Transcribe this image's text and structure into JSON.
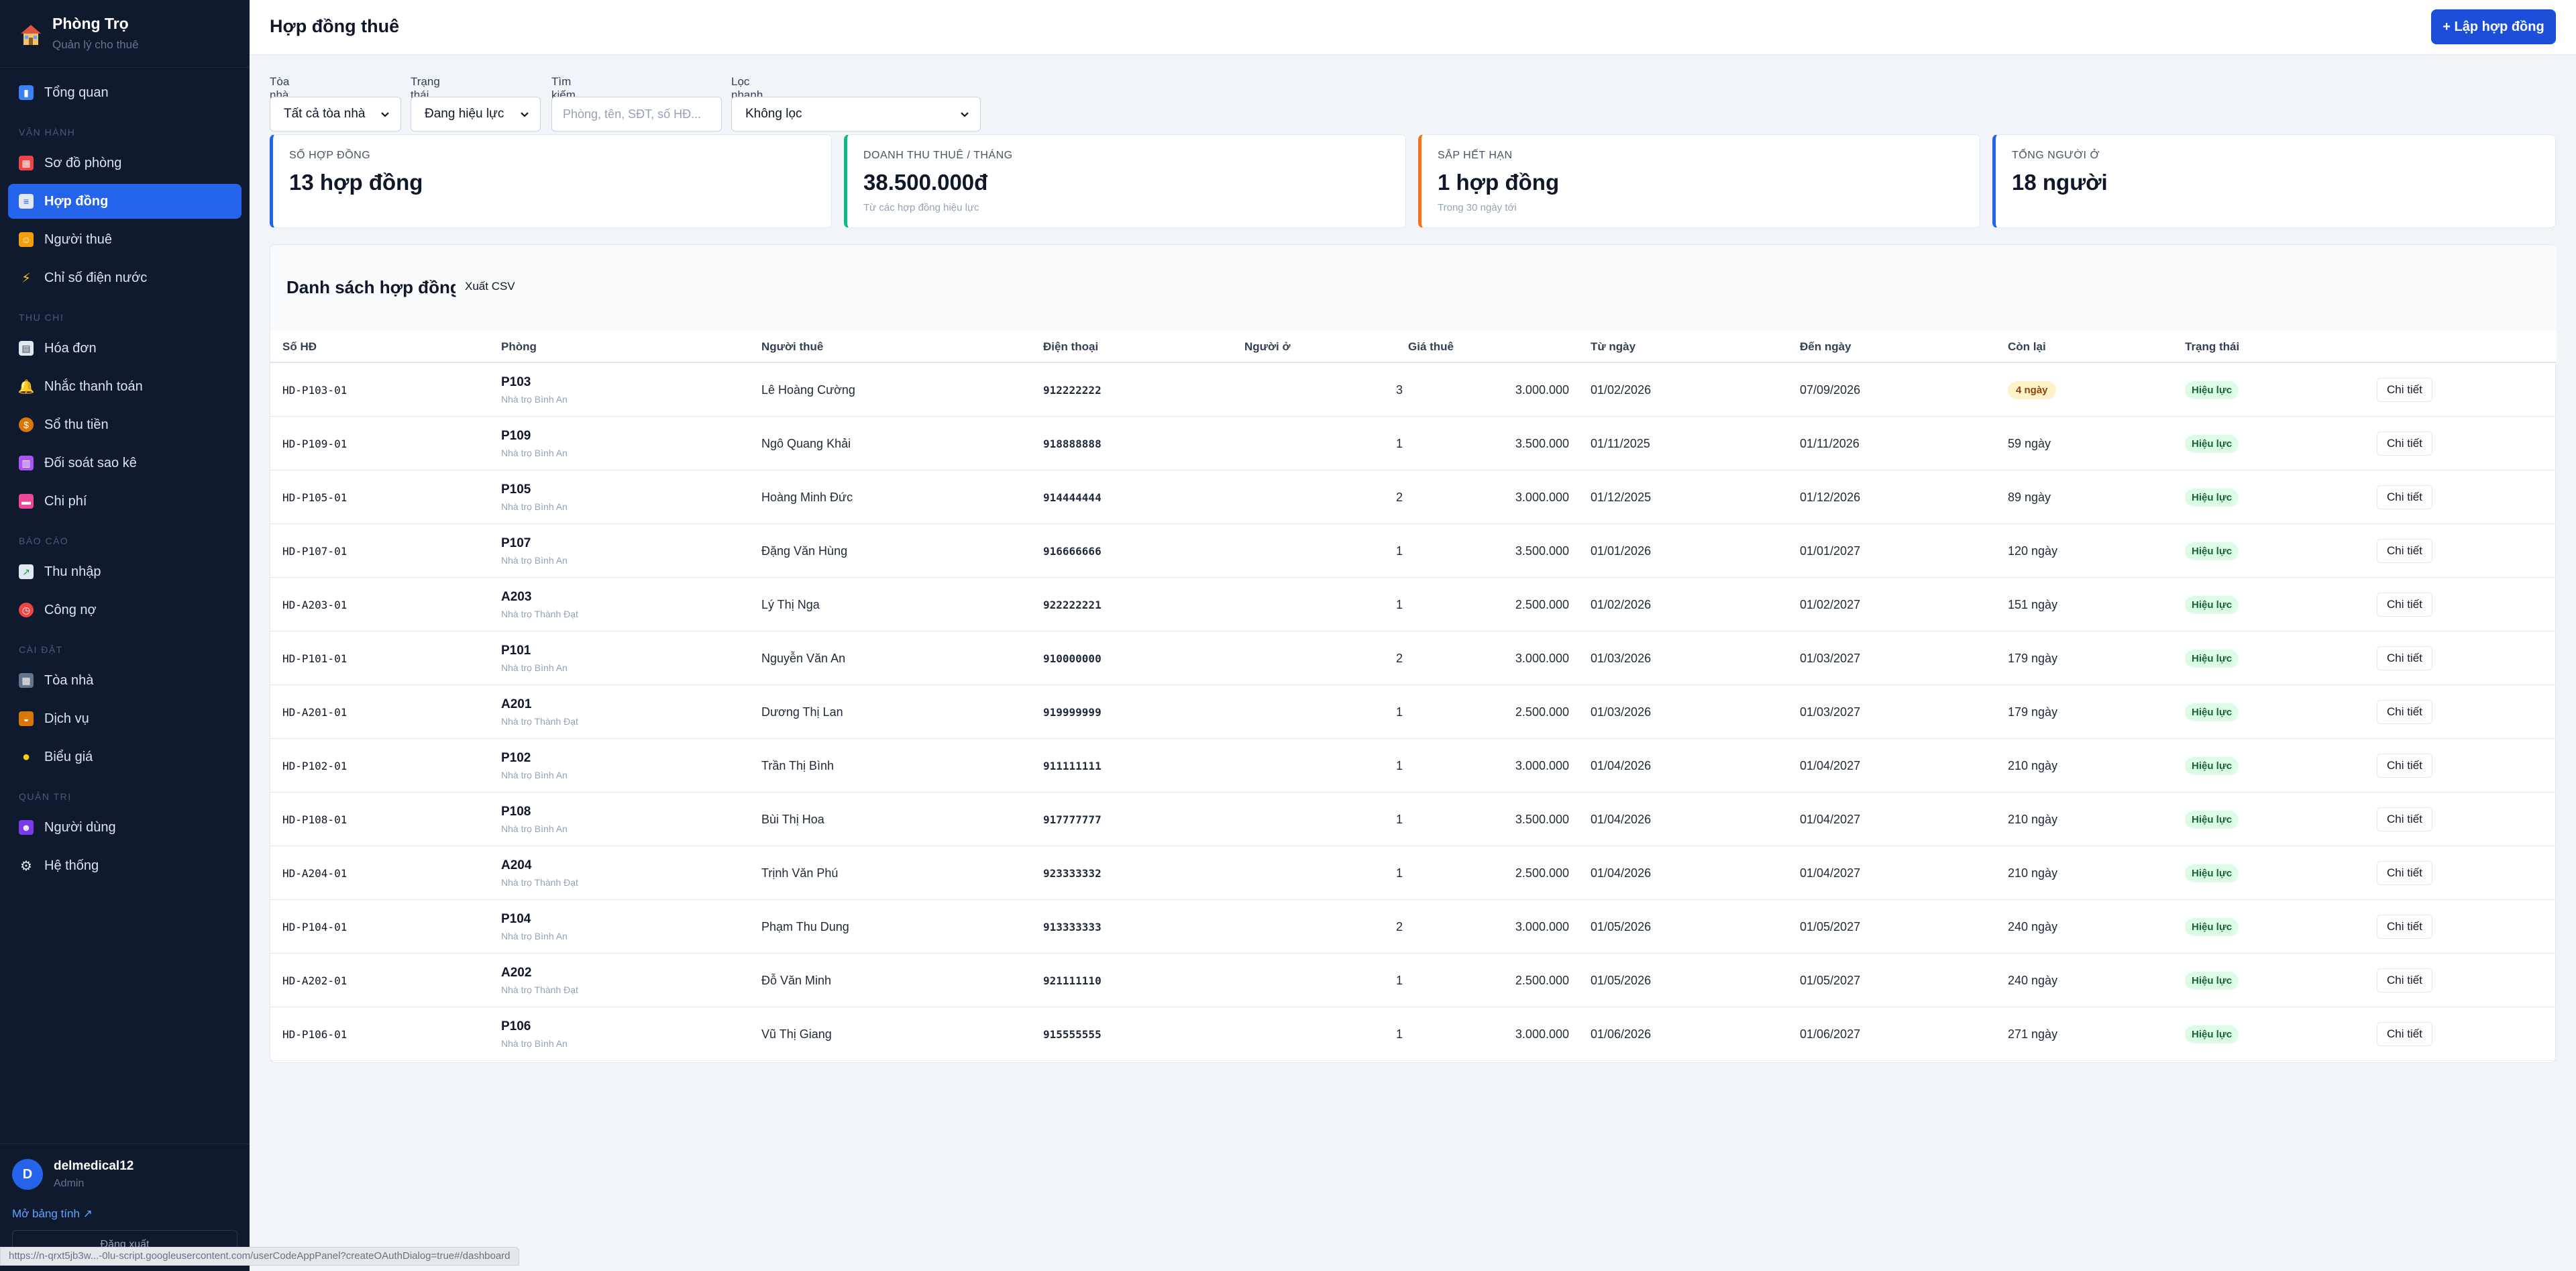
{
  "brand": {
    "title": "Phòng Trọ",
    "subtitle": "Quản lý cho thuê"
  },
  "nav": {
    "overview": "Tổng quan",
    "sec_ops": "Vận hành",
    "room_map": "Sơ đồ phòng",
    "contracts": "Hợp đồng",
    "tenants": "Người thuê",
    "meters": "Chỉ số điện nước",
    "sec_finance": "Thu chi",
    "invoices": "Hóa đơn",
    "reminders": "Nhắc thanh toán",
    "cashbook": "Sổ thu tiền",
    "reconcile": "Đối soát sao kê",
    "expenses": "Chi phí",
    "sec_reports": "Báo cáo",
    "income": "Thu nhập",
    "debts": "Công nợ",
    "sec_settings": "Cài đặt",
    "buildings": "Tòa nhà",
    "services": "Dịch vụ",
    "pricing": "Biểu giá",
    "sec_admin": "Quản trị",
    "users": "Người dùng",
    "system": "Hệ thống"
  },
  "user": {
    "initial": "D",
    "name": "delmedical12",
    "role": "Admin",
    "open_sheet": "Mở bảng tính ↗",
    "logout": "Đăng xuất"
  },
  "status_url": "https://n-qrxt5jb3w...-0lu-script.googleusercontent.com/userCodeAppPanel?createOAuthDialog=true#/dashboard",
  "header": {
    "title": "Hợp đồng thuê",
    "new_button": "+ Lập hợp đồng"
  },
  "filters": {
    "building_label": "Tòa nhà",
    "building_value": "Tất cả tòa nhà",
    "status_label": "Trạng thái",
    "status_value": "Đang hiệu lực",
    "search_label": "Tìm kiếm",
    "search_placeholder": "Phòng, tên, SĐT, số HĐ...",
    "quick_label": "Lọc nhanh",
    "quick_value": "Không lọc"
  },
  "stats": [
    {
      "label": "Số hợp đồng",
      "value": "13 hợp đồng",
      "note": "",
      "color": "#2563eb"
    },
    {
      "label": "Doanh thu thuê / tháng",
      "value": "38.500.000đ",
      "note": "Từ các hợp đồng hiệu lực",
      "color": "#10b981"
    },
    {
      "label": "Sắp hết hạn",
      "value": "1 hợp đồng",
      "note": "Trong 30 ngày tới",
      "color": "#f97316"
    },
    {
      "label": "Tổng người ở",
      "value": "18 người",
      "note": "",
      "color": "#2563eb"
    }
  ],
  "table": {
    "title": "Danh sách hợp đồng",
    "export": "Xuất CSV",
    "columns": [
      "Số HĐ",
      "Phòng",
      "Người thuê",
      "Điện thoại",
      "Người ở",
      "Giá thuê",
      "Từ ngày",
      "Đến ngày",
      "Còn lại",
      "Trạng thái"
    ],
    "detail_label": "Chi tiết",
    "rows": [
      {
        "id": "HD-P103-01",
        "room": "P103",
        "building": "Nhà trọ Bình An",
        "tenant": "Lê Hoàng Cường",
        "phone": "912222222",
        "occupants": "3",
        "rent": "3.000.000",
        "from": "01/02/2026",
        "to": "07/09/2026",
        "left": "4 ngày",
        "warn": true,
        "status": "Hiệu lực"
      },
      {
        "id": "HD-P109-01",
        "room": "P109",
        "building": "Nhà trọ Bình An",
        "tenant": "Ngô Quang Khải",
        "phone": "918888888",
        "occupants": "1",
        "rent": "3.500.000",
        "from": "01/11/2025",
        "to": "01/11/2026",
        "left": "59 ngày",
        "warn": false,
        "status": "Hiệu lực"
      },
      {
        "id": "HD-P105-01",
        "room": "P105",
        "building": "Nhà trọ Bình An",
        "tenant": "Hoàng Minh Đức",
        "phone": "914444444",
        "occupants": "2",
        "rent": "3.000.000",
        "from": "01/12/2025",
        "to": "01/12/2026",
        "left": "89 ngày",
        "warn": false,
        "status": "Hiệu lực"
      },
      {
        "id": "HD-P107-01",
        "room": "P107",
        "building": "Nhà trọ Bình An",
        "tenant": "Đặng Văn Hùng",
        "phone": "916666666",
        "occupants": "1",
        "rent": "3.500.000",
        "from": "01/01/2026",
        "to": "01/01/2027",
        "left": "120 ngày",
        "warn": false,
        "status": "Hiệu lực"
      },
      {
        "id": "HD-A203-01",
        "room": "A203",
        "building": "Nhà trọ Thành Đạt",
        "tenant": "Lý Thị Nga",
        "phone": "922222221",
        "occupants": "1",
        "rent": "2.500.000",
        "from": "01/02/2026",
        "to": "01/02/2027",
        "left": "151 ngày",
        "warn": false,
        "status": "Hiệu lực"
      },
      {
        "id": "HD-P101-01",
        "room": "P101",
        "building": "Nhà trọ Bình An",
        "tenant": "Nguyễn Văn An",
        "phone": "910000000",
        "occupants": "2",
        "rent": "3.000.000",
        "from": "01/03/2026",
        "to": "01/03/2027",
        "left": "179 ngày",
        "warn": false,
        "status": "Hiệu lực"
      },
      {
        "id": "HD-A201-01",
        "room": "A201",
        "building": "Nhà trọ Thành Đạt",
        "tenant": "Dương Thị Lan",
        "phone": "919999999",
        "occupants": "1",
        "rent": "2.500.000",
        "from": "01/03/2026",
        "to": "01/03/2027",
        "left": "179 ngày",
        "warn": false,
        "status": "Hiệu lực"
      },
      {
        "id": "HD-P102-01",
        "room": "P102",
        "building": "Nhà trọ Bình An",
        "tenant": "Trần Thị Bình",
        "phone": "911111111",
        "occupants": "1",
        "rent": "3.000.000",
        "from": "01/04/2026",
        "to": "01/04/2027",
        "left": "210 ngày",
        "warn": false,
        "status": "Hiệu lực"
      },
      {
        "id": "HD-P108-01",
        "room": "P108",
        "building": "Nhà trọ Bình An",
        "tenant": "Bùi Thị Hoa",
        "phone": "917777777",
        "occupants": "1",
        "rent": "3.500.000",
        "from": "01/04/2026",
        "to": "01/04/2027",
        "left": "210 ngày",
        "warn": false,
        "status": "Hiệu lực"
      },
      {
        "id": "HD-A204-01",
        "room": "A204",
        "building": "Nhà trọ Thành Đạt",
        "tenant": "Trịnh Văn Phú",
        "phone": "923333332",
        "occupants": "1",
        "rent": "2.500.000",
        "from": "01/04/2026",
        "to": "01/04/2027",
        "left": "210 ngày",
        "warn": false,
        "status": "Hiệu lực"
      },
      {
        "id": "HD-P104-01",
        "room": "P104",
        "building": "Nhà trọ Bình An",
        "tenant": "Phạm Thu Dung",
        "phone": "913333333",
        "occupants": "2",
        "rent": "3.000.000",
        "from": "01/05/2026",
        "to": "01/05/2027",
        "left": "240 ngày",
        "warn": false,
        "status": "Hiệu lực"
      },
      {
        "id": "HD-A202-01",
        "room": "A202",
        "building": "Nhà trọ Thành Đạt",
        "tenant": "Đỗ Văn Minh",
        "phone": "921111110",
        "occupants": "1",
        "rent": "2.500.000",
        "from": "01/05/2026",
        "to": "01/05/2027",
        "left": "240 ngày",
        "warn": false,
        "status": "Hiệu lực"
      },
      {
        "id": "HD-P106-01",
        "room": "P106",
        "building": "Nhà trọ Bình An",
        "tenant": "Vũ Thị Giang",
        "phone": "915555555",
        "occupants": "1",
        "rent": "3.000.000",
        "from": "01/06/2026",
        "to": "01/06/2027",
        "left": "271 ngày",
        "warn": false,
        "status": "Hiệu lực"
      }
    ]
  }
}
